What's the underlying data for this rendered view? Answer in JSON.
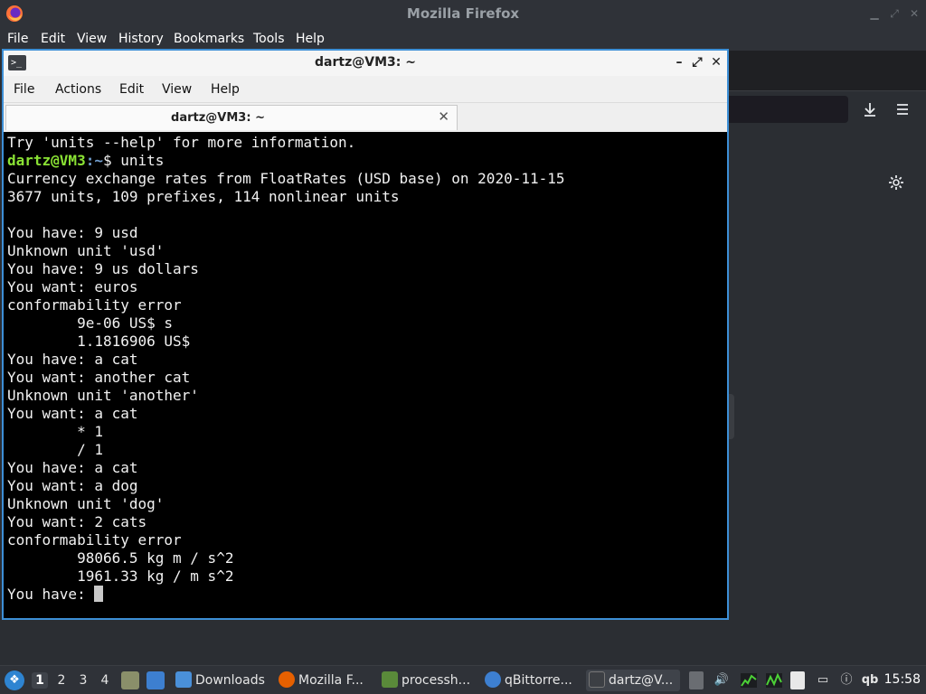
{
  "firefox": {
    "title": "Mozilla Firefox",
    "menu": [
      {
        "label": "File"
      },
      {
        "label": "Edit"
      },
      {
        "label": "View"
      },
      {
        "label": "History"
      },
      {
        "label": "Bookmarks"
      },
      {
        "label": "Tools"
      },
      {
        "label": "Help"
      }
    ],
    "icons": {
      "download": "download-icon",
      "menu": "hamburger-menu-icon",
      "settings": "gear-icon"
    }
  },
  "terminal": {
    "title": "dartz@VM3: ~",
    "menu": [
      {
        "label": "File"
      },
      {
        "label": "Actions"
      },
      {
        "label": "Edit"
      },
      {
        "label": "View"
      },
      {
        "label": "Help"
      }
    ],
    "tab_label": "dartz@VM3: ~",
    "lines": [
      "Try 'units --help' for more information.",
      "PROMPT",
      "Currency exchange rates from FloatRates (USD base) on 2020-11-15",
      "3677 units, 109 prefixes, 114 nonlinear units",
      "",
      "You have: 9 usd",
      "Unknown unit 'usd'",
      "You have: 9 us dollars",
      "You want: euros",
      "conformability error",
      "        9e-06 US$ s",
      "        1.1816906 US$",
      "You have: a cat",
      "You want: another cat",
      "Unknown unit 'another'",
      "You want: a cat",
      "        * 1",
      "        / 1",
      "You have: a cat",
      "You want: a dog",
      "Unknown unit 'dog'",
      "You want: 2 cats",
      "conformability error",
      "        98066.5 kg m / s^2",
      "        1961.33 kg / m s^2"
    ],
    "prompt": {
      "user": "dartz@VM3",
      "path": ":~",
      "symbol": "$ ",
      "command": "units"
    },
    "last_line": "You have: "
  },
  "taskbar": {
    "workspaces": [
      "1",
      "2",
      "3",
      "4"
    ],
    "tasks": [
      {
        "label": "Downloads",
        "icon": "folder-icon",
        "color": "#4a90d9"
      },
      {
        "label": "Mozilla F...",
        "icon": "firefox-icon",
        "color": "#e66000"
      },
      {
        "label": "processh...",
        "icon": "process-monitor-icon",
        "color": "#5a8a3a"
      },
      {
        "label": "qBittorre...",
        "icon": "qbittorrent-icon",
        "color": "#3d7fd0"
      },
      {
        "label": "dartz@V...",
        "icon": "terminal-icon",
        "color": "#3c3f44"
      }
    ],
    "tray_qb": "qb",
    "clock": "15:58"
  }
}
